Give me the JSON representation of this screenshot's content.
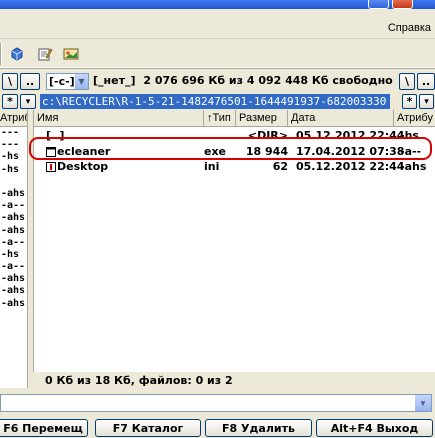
{
  "menu": {
    "help_label": "Справка"
  },
  "toolbar": {
    "icons": [
      "cube-icon",
      "edit-icon",
      "image-icon"
    ]
  },
  "drivebar": {
    "root_btn": "\\",
    "up_btn": "..",
    "drive_value": "[-c-]",
    "volume_label": "[_нет_]",
    "free_space": "2 076 696 Кб из 4 092 448 Кб свободно",
    "right_root_btn": "\\",
    "right_up_btn": ".."
  },
  "pathbar": {
    "path": "c:\\RECYCLER\\R-1-5-21-1482476501-1644491937-682003330",
    "star_btn": "*",
    "dropdown_btn": "▾"
  },
  "left_panel": {
    "header": "Атрибу",
    "attrs": [
      "---",
      "---",
      "-hs",
      "-hs",
      "",
      "-ahs",
      "-a--",
      "-ahs",
      "-ahs",
      "-a--",
      "-hs",
      "-a--",
      "-ahs",
      "-ahs",
      "-ahs"
    ]
  },
  "columns": {
    "name": "Имя",
    "type": "↑Тип",
    "size": "Размер",
    "date": "Дата",
    "attr": "Атрибу"
  },
  "files": [
    {
      "name": "[..]",
      "type": "",
      "size": "<DIR>",
      "date": "05.12.2012 22:44",
      "attr": "-hs"
    },
    {
      "name": "ecleaner",
      "type": "exe",
      "size": "18 944",
      "date": "17.04.2012 07:38",
      "attr": "-a--"
    },
    {
      "name": "Desktop",
      "type": "ini",
      "size": "62",
      "date": "05.12.2012 22:44",
      "attr": "-ahs"
    }
  ],
  "status": {
    "text": "0 Кб из 18 Кб, файлов: 0 из 2"
  },
  "fkeys": [
    "F6 Перемещ",
    "F7 Каталог",
    "F8 Удалить",
    "Alt+F4 Выход"
  ],
  "colors": {
    "selection": "#316ac5",
    "highlight_ring": "#d90000",
    "face": "#ece9d8"
  }
}
